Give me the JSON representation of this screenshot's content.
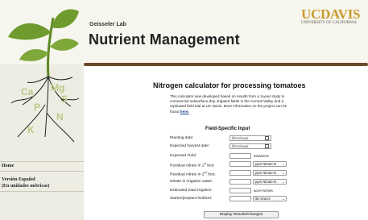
{
  "header": {
    "lab": "Geisseler Lab",
    "title": "Nutrient Management",
    "uc_logo": "UCDAVIS",
    "uc_sub": "UNIVERSITY OF CALIFORNIA",
    "plant_letters": [
      "Ca",
      "Mg",
      "P",
      "S",
      "N",
      "K"
    ]
  },
  "sidebar": {
    "items": [
      {
        "label": "Home"
      },
      {
        "label": "Versión Español"
      },
      {
        "label": "(En unidades métricas)"
      }
    ]
  },
  "main": {
    "title": "Nitrogen calculator for processing tomatoes",
    "intro": "This calculator was developed based on results from a 3-year study in commercial subsurface-drip irrigated fields in the Central Valley and a replicated field trial at UC Davis. More information on the project can be found",
    "intro_link": "here.",
    "section_title": "Field-Specific Input",
    "fields": {
      "planting_date": {
        "label": "Planting date:",
        "placeholder": "ll/mm/aaaa"
      },
      "harvest_date": {
        "label": "Expected harvest date:",
        "placeholder": "ll/mm/aaaa"
      },
      "yield": {
        "label": "Expected Yield:",
        "unit": "tons/acre"
      },
      "nitrate_1": {
        "label_pre": "Residual nitrate in 1",
        "label_sup": "st",
        "label_post": " foot:",
        "select": "ppm Nitrate-N"
      },
      "nitrate_2": {
        "label_pre": "Residual nitrate in 2",
        "label_sup": "nd",
        "label_post": " foot:",
        "select": "ppm Nitrate-N"
      },
      "irrigation_nitrate": {
        "label": "Nitrate in irrigation water:",
        "select": "ppm Nitrate-N"
      },
      "total_irrigation": {
        "label": "Estimated total irrigation:",
        "unit": "acre-inches"
      },
      "starter": {
        "label": "Starter/preplant fertilizer:",
        "select": "lbs N/acre"
      }
    },
    "button": "Display Results/Changes"
  },
  "icons": {
    "calendar": "calendar-icon",
    "dropdown": "chevron-down-icon"
  },
  "colors": {
    "uc_gold": "#c99a2e",
    "rule": "#6b4a2a",
    "leaf": "#6f9a2d",
    "sidebar_bg": "#eeede3"
  }
}
